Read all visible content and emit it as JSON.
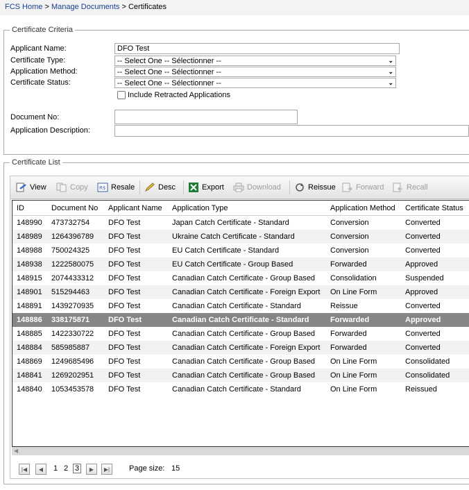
{
  "breadcrumb": {
    "home": "FCS Home",
    "sep": ">",
    "manage": "Manage Documents",
    "current": "Certificates"
  },
  "criteria": {
    "legend": "Certificate Criteria",
    "applicant_name_label": "Applicant Name:",
    "applicant_name_value": "DFO Test",
    "certificate_type_label": "Certificate Type:",
    "application_method_label": "Application Method:",
    "certificate_status_label": "Certificate Status:",
    "select_placeholder": "-- Select One -- Sélectionner --",
    "include_retracted_label": "Include Retracted Applications",
    "document_no_label": "Document No:",
    "application_description_label": "Application Description:"
  },
  "list": {
    "legend": "Certificate List",
    "toolbar": {
      "view": "View",
      "copy": "Copy",
      "resale": "Resale",
      "desc": "Desc",
      "export": "Export",
      "download": "Download",
      "reissue": "Reissue",
      "forward": "Forward",
      "recall": "Recall"
    },
    "columns": [
      "ID",
      "Document No",
      "Applicant Name",
      "Application Type",
      "Application Method",
      "Certificate Status"
    ],
    "rows": [
      [
        "148990",
        "473732754",
        "DFO Test",
        "Japan Catch Certificate - Standard",
        "Conversion",
        "Converted"
      ],
      [
        "148989",
        "1264396789",
        "DFO Test",
        "Ukraine Catch Certificate - Standard",
        "Conversion",
        "Converted"
      ],
      [
        "148988",
        "750024325",
        "DFO Test",
        "EU Catch Certificate - Standard",
        "Conversion",
        "Converted"
      ],
      [
        "148938",
        "1222580075",
        "DFO Test",
        "EU Catch Certificate - Group Based",
        "Forwarded",
        "Approved"
      ],
      [
        "148915",
        "2074433312",
        "DFO Test",
        "Canadian Catch Certificate - Group Based",
        "Consolidation",
        "Suspended"
      ],
      [
        "148901",
        "515294463",
        "DFO Test",
        "Canadian Catch Certificate - Foreign Export",
        "On Line Form",
        "Approved"
      ],
      [
        "148891",
        "1439270935",
        "DFO Test",
        "Canadian Catch Certificate - Standard",
        "Reissue",
        "Converted"
      ],
      [
        "148886",
        "338175871",
        "DFO Test",
        "Canadian Catch Certificate - Standard",
        "Forwarded",
        "Approved"
      ],
      [
        "148885",
        "1422330722",
        "DFO Test",
        "Canadian Catch Certificate - Group Based",
        "Forwarded",
        "Converted"
      ],
      [
        "148884",
        "585985887",
        "DFO Test",
        "Canadian Catch Certificate - Foreign Export",
        "Forwarded",
        "Converted"
      ],
      [
        "148869",
        "1249685496",
        "DFO Test",
        "Canadian Catch Certificate - Group Based",
        "On Line Form",
        "Consolidated"
      ],
      [
        "148841",
        "1269202951",
        "DFO Test",
        "Canadian Catch Certificate - Group Based",
        "On Line Form",
        "Consolidated"
      ],
      [
        "148840",
        "1053453578",
        "DFO Test",
        "Canadian Catch Certificate - Standard",
        "On Line Form",
        "Reissued"
      ]
    ],
    "selected_row": 7,
    "pager": {
      "pages": [
        "1",
        "2",
        "3"
      ],
      "current_page": "3",
      "page_size_label": "Page size:",
      "page_size_value": "15"
    }
  }
}
